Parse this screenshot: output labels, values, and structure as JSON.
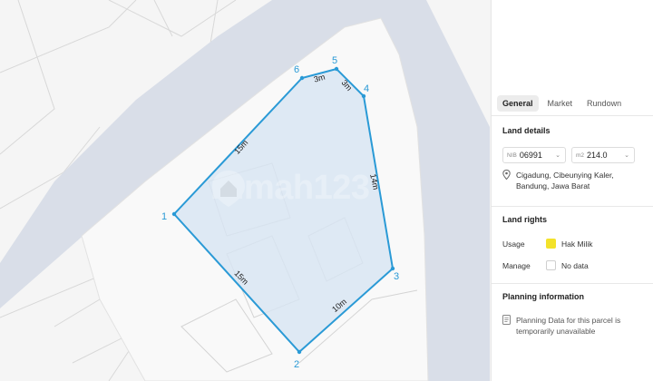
{
  "map": {
    "parcel": {
      "vertex_labels": [
        "1",
        "2",
        "3",
        "4",
        "5",
        "6"
      ],
      "edge_labels": [
        "15m",
        "10m",
        "14m",
        "3m",
        "3m",
        "15m"
      ],
      "stroke_color": "#2a9ad6",
      "fill_color": "#d7e5f2"
    },
    "watermark": {
      "text": "rumah123",
      "icon": "house-pin-icon"
    }
  },
  "panel": {
    "tabs": [
      {
        "label": "General",
        "active": true
      },
      {
        "label": "Market",
        "active": false
      },
      {
        "label": "Rundown",
        "active": false
      }
    ],
    "land_details": {
      "title": "Land details",
      "nib": {
        "prefix": "NIB",
        "value": "06991"
      },
      "area": {
        "prefix": "m2",
        "value": "214.0"
      },
      "address_icon": "location-pin-icon",
      "address": "Cigadung, Cibeunying Kaler, Bandung, Jawa Barat"
    },
    "land_rights": {
      "title": "Land rights",
      "usage": {
        "label": "Usage",
        "value": "Hak Milik",
        "color": "#f3e22a"
      },
      "manage": {
        "label": "Manage",
        "value": "No data",
        "color": "#ffffff"
      }
    },
    "planning": {
      "title": "Planning information",
      "icon": "document-icon",
      "message": "Planning Data for this parcel is temporarily unavailable"
    }
  }
}
